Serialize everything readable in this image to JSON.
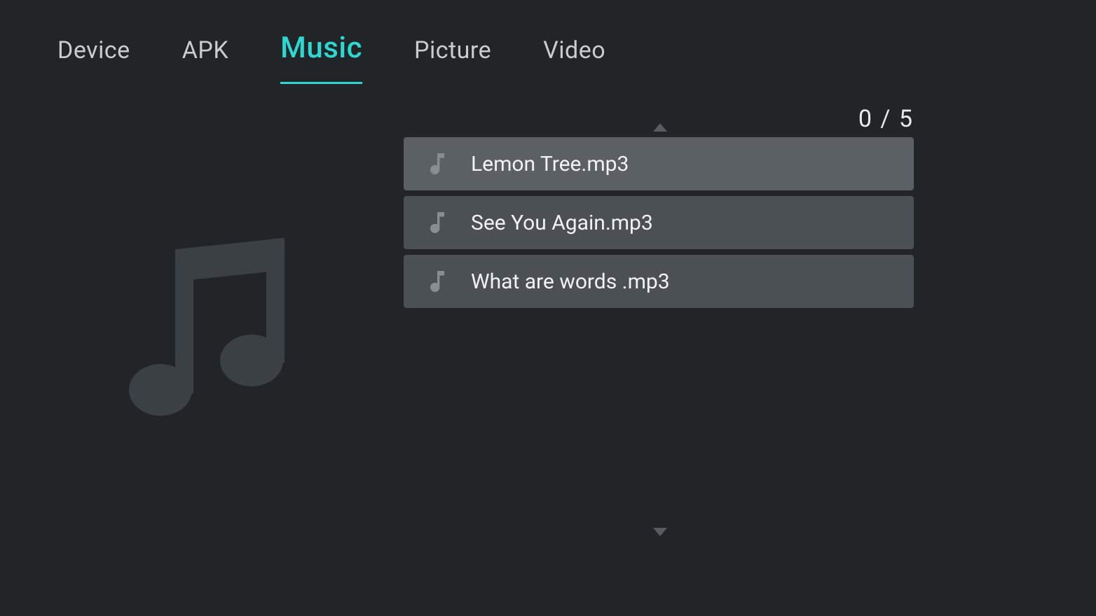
{
  "tabs": [
    {
      "label": "Device",
      "slug": "device",
      "active": false
    },
    {
      "label": "APK",
      "slug": "apk",
      "active": false
    },
    {
      "label": "Music",
      "slug": "music",
      "active": true
    },
    {
      "label": "Picture",
      "slug": "picture",
      "active": false
    },
    {
      "label": "Video",
      "slug": "video",
      "active": false
    }
  ],
  "counter": "0 / 5",
  "files": [
    {
      "name": "Lemon Tree.mp3",
      "highlight": true
    },
    {
      "name": "See You Again.mp3",
      "highlight": false
    },
    {
      "name": "What are words .mp3",
      "highlight": false
    }
  ]
}
